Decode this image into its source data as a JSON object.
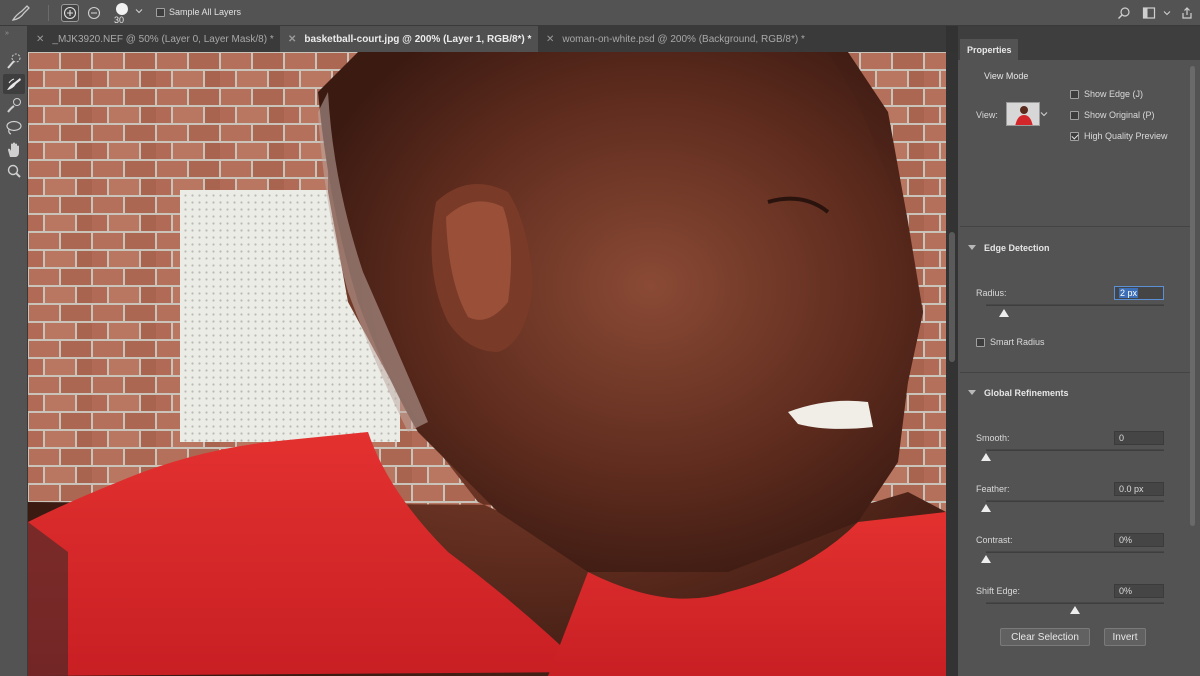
{
  "options_bar": {
    "brush_size": "30",
    "sample_all_layers_label": "Sample All Layers",
    "sample_all_layers_checked": false
  },
  "tabs": [
    {
      "label": "_MJK3920.NEF @ 50% (Layer 0, Layer Mask/8) *",
      "active": false
    },
    {
      "label": "basketball-court.jpg @ 200% (Layer 1, RGB/8*) *",
      "active": true
    },
    {
      "label": "woman-on-white.psd @ 200% (Background, RGB/8*) *",
      "active": false
    }
  ],
  "tools": [
    "quick-selection-brush-icon",
    "refine-edge-brush-icon",
    "brush-icon",
    "lasso-icon",
    "hand-icon",
    "zoom-icon"
  ],
  "properties": {
    "tab_label": "Properties",
    "view_mode": {
      "title": "View Mode",
      "view_label": "View:",
      "show_edge": {
        "label": "Show Edge (J)",
        "checked": false
      },
      "show_original": {
        "label": "Show Original (P)",
        "checked": false
      },
      "high_quality_preview": {
        "label": "High Quality Preview",
        "checked": true
      }
    },
    "edge_detection": {
      "title": "Edge Detection",
      "radius_label": "Radius:",
      "radius_value": "2 px",
      "radius_slider_fraction": 0.1,
      "smart_radius": {
        "label": "Smart Radius",
        "checked": false
      }
    },
    "global_refinements": {
      "title": "Global Refinements",
      "smooth": {
        "label": "Smooth:",
        "value": "0",
        "fraction": 0.0
      },
      "feather": {
        "label": "Feather:",
        "value": "0.0 px",
        "fraction": 0.0
      },
      "contrast": {
        "label": "Contrast:",
        "value": "0%",
        "fraction": 0.0
      },
      "shift_edge": {
        "label": "Shift Edge:",
        "value": "0%",
        "fraction": 0.5
      }
    },
    "buttons": {
      "clear_selection": "Clear Selection",
      "invert": "Invert"
    }
  }
}
